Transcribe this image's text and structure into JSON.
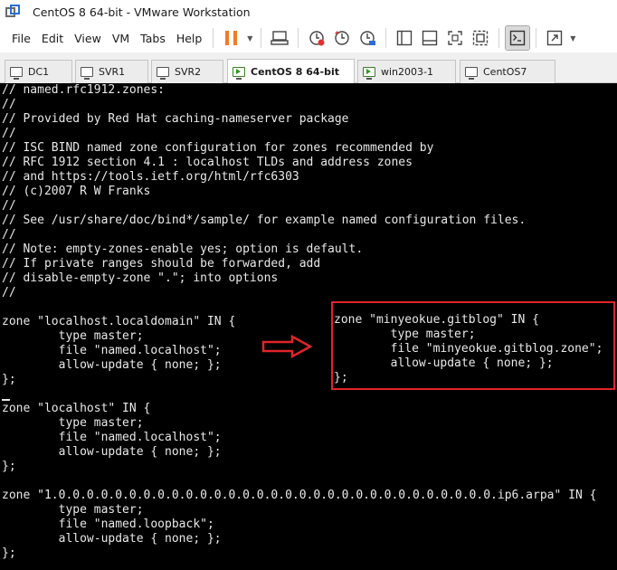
{
  "window": {
    "title": "CentOS 8 64-bit - VMware Workstation"
  },
  "menu": {
    "items": [
      "File",
      "Edit",
      "View",
      "VM",
      "Tabs",
      "Help"
    ]
  },
  "tabs": [
    "DC1",
    "SVR1",
    "SVR2",
    "CentOS 8 64-bit",
    "win2003-1",
    "CentOS7"
  ],
  "console": {
    "lines": [
      "// named.rfc1912.zones:",
      "//",
      "// Provided by Red Hat caching-nameserver package",
      "//",
      "// ISC BIND named zone configuration for zones recommended by",
      "// RFC 1912 section 4.1 : localhost TLDs and address zones",
      "// and https://tools.ietf.org/html/rfc6303",
      "// (c)2007 R W Franks",
      "//",
      "// See /usr/share/doc/bind*/sample/ for example named configuration files.",
      "//",
      "// Note: empty-zones-enable yes; option is default.",
      "// If private ranges should be forwarded, add",
      "// disable-empty-zone \".\"; into options",
      "//",
      "",
      "zone \"localhost.localdomain\" IN {",
      "        type master;",
      "        file \"named.localhost\";",
      "        allow-update { none; };",
      "};",
      "",
      "zone \"localhost\" IN {",
      "        type master;",
      "        file \"named.localhost\";",
      "        allow-update { none; };",
      "};",
      "",
      "zone \"1.0.0.0.0.0.0.0.0.0.0.0.0.0.0.0.0.0.0.0.0.0.0.0.0.0.0.0.0.0.0.0.ip6.arpa\" IN {",
      "        type master;",
      "        file \"named.loopback\";",
      "        allow-update { none; };",
      "};"
    ],
    "annotation_lines": [
      "zone \"minyeokue.gitblog\" IN {",
      "        type master;",
      "        file \"minyeokue.gitblog.zone\";",
      "        allow-update { none; };",
      "};"
    ]
  },
  "colors": {
    "console_bg": "#000000",
    "console_text": "#e8e8e8",
    "annotation_red": "#e0242a",
    "pause_orange": "#f07c22"
  }
}
